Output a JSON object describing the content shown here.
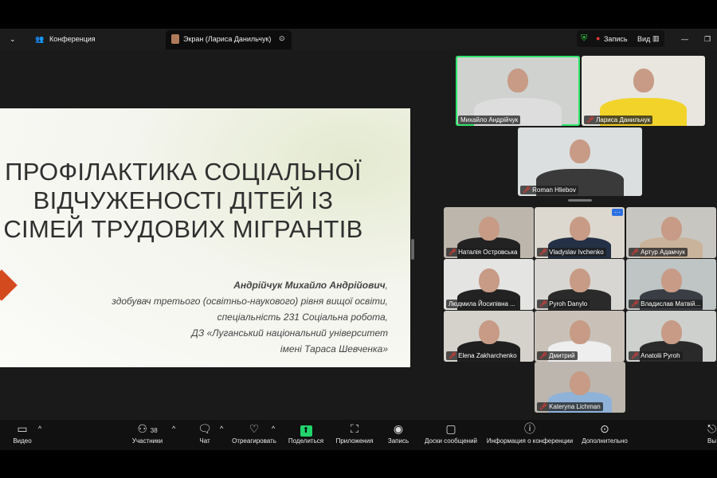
{
  "topbar": {
    "conference": "Конференция",
    "screen_tab": "Экран (Лариса Данильчук)",
    "record": "Запись",
    "view": "Вид"
  },
  "slide": {
    "title": "ПРОФІЛАКТИКА СОЦІАЛЬНОЇ ВІДЧУЖЕНОСТІ ДІТЕЙ ІЗ СІМЕЙ ТРУДОВИХ МІГРАНТІВ",
    "author_name": "Андрійчук Михайло Андрійович",
    "author_lines": [
      "здобувач третього (освітньо-наукового) рівня вищої освіти,",
      "спеціальність 231 Соціальна робота,",
      "ДЗ «Луганський національний університет",
      "імені Тараса Шевченка»"
    ]
  },
  "speakers": [
    {
      "name": "Михайло Андрійчук",
      "muted": false,
      "active": true
    },
    {
      "name": "Лариса Данильчук",
      "muted": true
    },
    {
      "name": "Roman Hliebov",
      "muted": true
    }
  ],
  "gallery": [
    {
      "name": "Наталія Островська",
      "muted": true
    },
    {
      "name": "Vladyslav Ivchenko",
      "muted": true
    },
    {
      "name": "Артур Адамчук",
      "muted": true
    },
    {
      "name": "Людмила Йосипівна ...",
      "muted": false
    },
    {
      "name": "Pyroh Danylo",
      "muted": true
    },
    {
      "name": "Владислав Матвій...",
      "muted": true
    },
    {
      "name": "Elena Zakharchenko",
      "muted": true
    },
    {
      "name": "Дмитрий",
      "muted": true
    },
    {
      "name": "Anatolii Pyroh",
      "muted": true
    },
    {
      "name": "Kateryna Lichman",
      "muted": true
    }
  ],
  "toolbar": {
    "video": "Видео",
    "participants": "Участники",
    "participants_count": "38",
    "chat": "Чат",
    "react": "Отреагировать",
    "share": "Поделиться",
    "apps": "Приложения",
    "record": "Запись",
    "whiteboards": "Доски сообщений",
    "info": "Информация о конференции",
    "more": "Дополнительно",
    "leave": "Вы"
  }
}
